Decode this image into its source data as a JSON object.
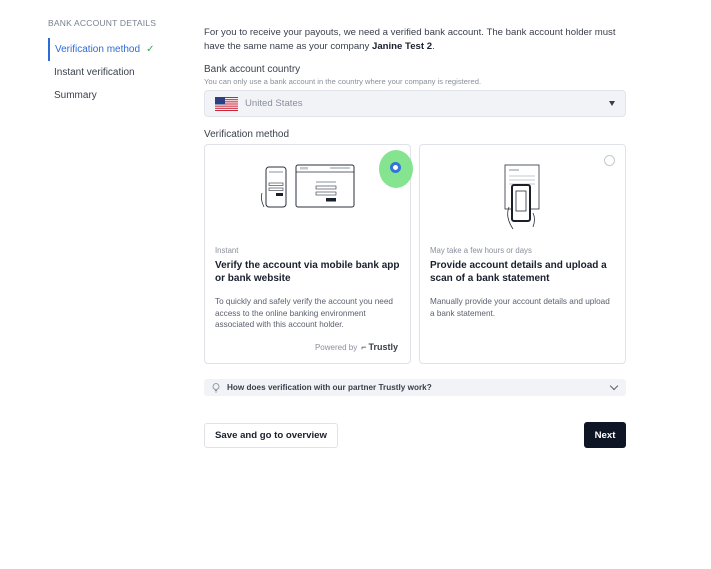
{
  "sidebar": {
    "heading": "BANK ACCOUNT DETAILS",
    "steps": [
      {
        "label": "Verification method",
        "active": true,
        "completed": true
      },
      {
        "label": "Instant verification",
        "active": false
      },
      {
        "label": "Summary",
        "active": false
      }
    ],
    "check_glyph": "✓"
  },
  "intro": {
    "text": "For you to receive your payouts, we need a verified bank account. The bank account holder must have the same name as your company ",
    "company": "Janine Test 2",
    "suffix": "."
  },
  "country": {
    "label": "Bank account country",
    "hint": "You can only use a bank account in the country where your company is registered.",
    "value": "United States",
    "flag_icon": "us-flag-icon"
  },
  "verification": {
    "label": "Verification method",
    "options": [
      {
        "meta": "Instant",
        "title": "Verify the account via mobile bank app or bank website",
        "description": "To quickly and safely verify the account you need access to the online banking environment associated with this account holder.",
        "powered_by": "Powered by",
        "provider": "Trustly",
        "selected": true
      },
      {
        "meta": "May take a few hours or days",
        "title": "Provide account details and upload a scan of a bank statement",
        "description": "Manually provide your account details and upload a bank statement.",
        "selected": false
      }
    ]
  },
  "accordion": {
    "text": "How does verification with our partner Trustly work?"
  },
  "actions": {
    "secondary_label": "Save and go to overview",
    "primary_label": "Next"
  },
  "colors": {
    "accent": "#2d6bd8",
    "primary_button": "#0e1626",
    "check": "#3aa655",
    "highlight": "#7ee38a"
  }
}
